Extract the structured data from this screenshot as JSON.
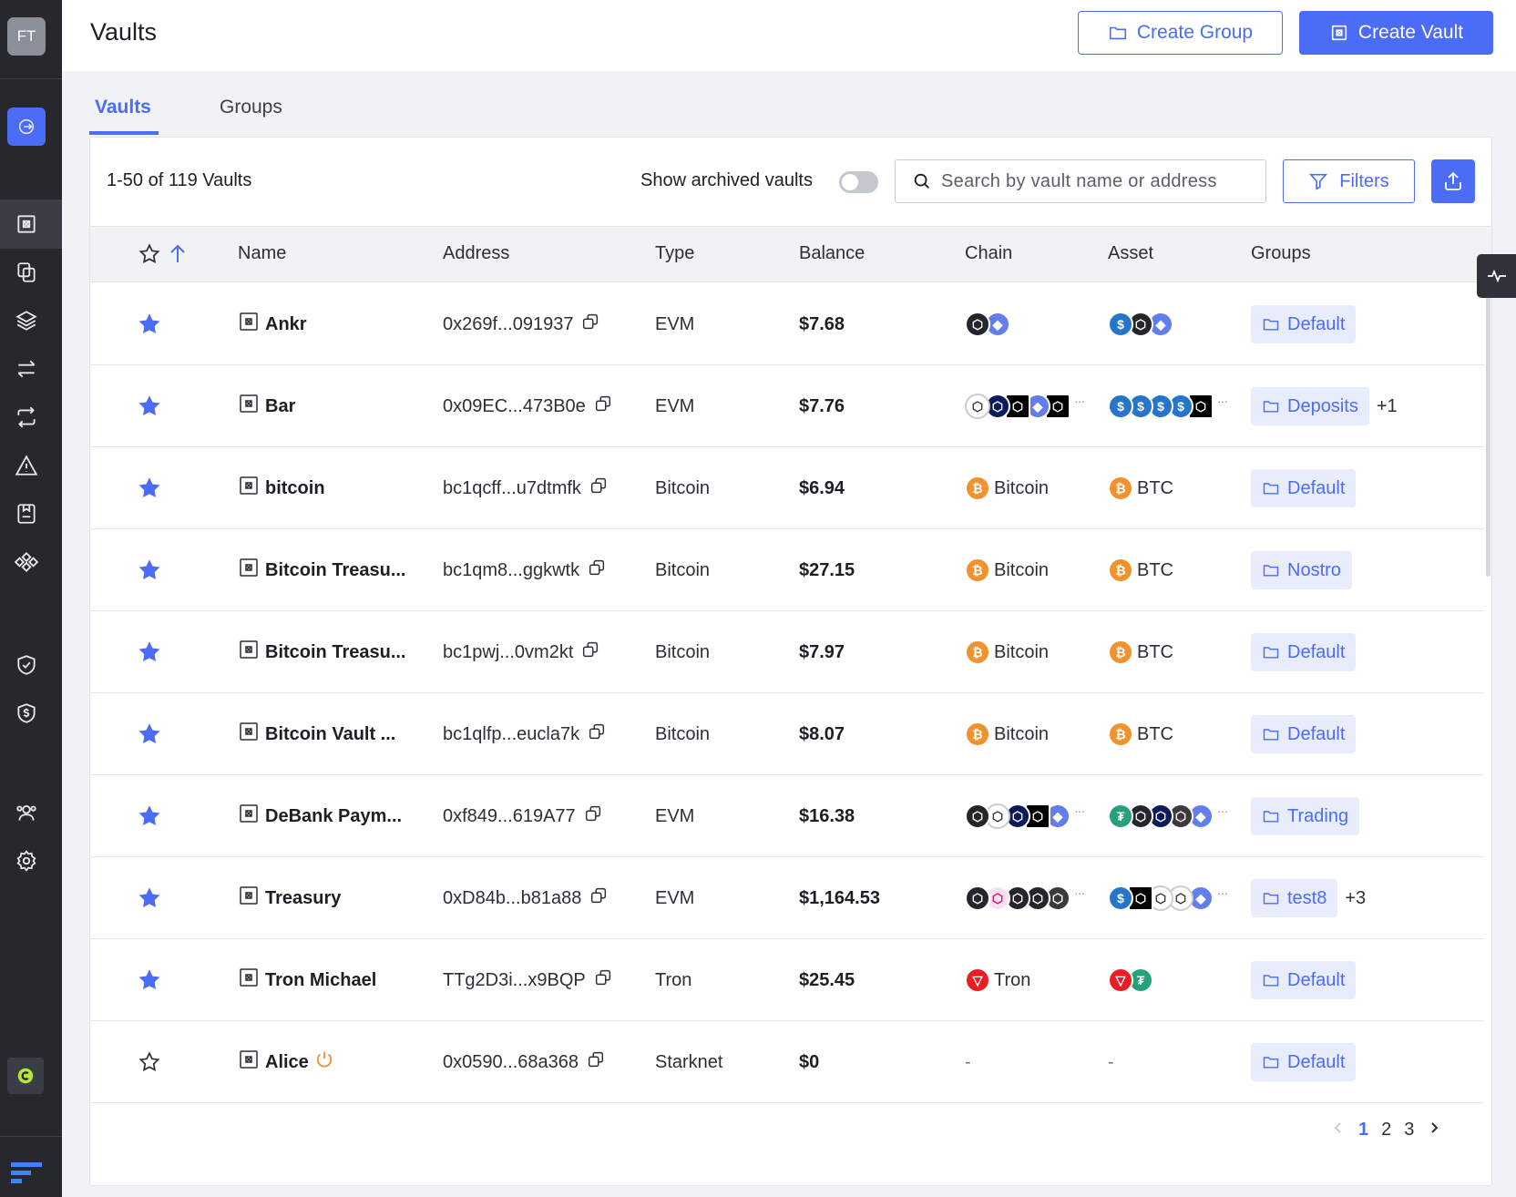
{
  "user": {
    "initials": "FT"
  },
  "header": {
    "title": "Vaults",
    "create_group": "Create Group",
    "create_vault": "Create Vault"
  },
  "tabs": [
    {
      "label": "Vaults",
      "active": true
    },
    {
      "label": "Groups",
      "active": false
    }
  ],
  "toolbar": {
    "count": "1-50 of 119 Vaults",
    "archived_label": "Show archived vaults",
    "archived_on": false,
    "search_placeholder": "Search by vault name or address",
    "filters_label": "Filters"
  },
  "columns": [
    "Name",
    "Address",
    "Type",
    "Balance",
    "Chain",
    "Asset",
    "Groups"
  ],
  "rows": [
    {
      "starred": true,
      "name": "Ankr",
      "address": "0x269f...091937",
      "type": "EVM",
      "balance": "$7.68",
      "chain_icons": [
        "dark",
        "eth"
      ],
      "chain_label": "",
      "asset_icons": [
        "usdc",
        "dark",
        "eth"
      ],
      "asset_label": "",
      "group": "Default",
      "group_extra": ""
    },
    {
      "starred": true,
      "name": "Bar",
      "address": "0x09EC...473B0e",
      "type": "EVM",
      "balance": "$7.76",
      "chain_icons": [
        "white",
        "blue-dark",
        "black",
        "eth",
        "black"
      ],
      "chain_label": "",
      "asset_icons": [
        "usdc",
        "usdc",
        "usdc",
        "usdc",
        "black"
      ],
      "asset_label": "",
      "group": "Deposits",
      "group_extra": "+1"
    },
    {
      "starred": true,
      "name": "bitcoin",
      "address": "bc1qcff...u7dtmfk",
      "type": "Bitcoin",
      "balance": "$6.94",
      "chain_icons": [
        "btc"
      ],
      "chain_label": "Bitcoin",
      "asset_icons": [
        "btc"
      ],
      "asset_label": "BTC",
      "group": "Default",
      "group_extra": ""
    },
    {
      "starred": true,
      "name": "Bitcoin Treasu...",
      "address": "bc1qm8...ggkwtk",
      "type": "Bitcoin",
      "balance": "$27.15",
      "chain_icons": [
        "btc"
      ],
      "chain_label": "Bitcoin",
      "asset_icons": [
        "btc"
      ],
      "asset_label": "BTC",
      "group": "Nostro",
      "group_extra": ""
    },
    {
      "starred": true,
      "name": "Bitcoin Treasu...",
      "address": "bc1pwj...0vm2kt",
      "type": "Bitcoin",
      "balance": "$7.97",
      "chain_icons": [
        "btc"
      ],
      "chain_label": "Bitcoin",
      "asset_icons": [
        "btc"
      ],
      "asset_label": "BTC",
      "group": "Default",
      "group_extra": ""
    },
    {
      "starred": true,
      "name": "Bitcoin Vault ...",
      "address": "bc1qlfp...eucla7k",
      "type": "Bitcoin",
      "balance": "$8.07",
      "chain_icons": [
        "btc"
      ],
      "chain_label": "Bitcoin",
      "asset_icons": [
        "btc"
      ],
      "asset_label": "BTC",
      "group": "Default",
      "group_extra": ""
    },
    {
      "starred": true,
      "name": "DeBank Paym...",
      "address": "0xf849...619A77",
      "type": "EVM",
      "balance": "$16.38",
      "chain_icons": [
        "dark",
        "white",
        "blue-dark",
        "black",
        "eth"
      ],
      "chain_label": "",
      "asset_icons": [
        "teal",
        "dark",
        "blue-dark",
        "green",
        "eth"
      ],
      "asset_label": "",
      "group": "Trading",
      "group_extra": ""
    },
    {
      "starred": true,
      "name": "Treasury",
      "address": "0xD84b...b81a88",
      "type": "EVM",
      "balance": "$1,164.53",
      "chain_icons": [
        "dark",
        "pink",
        "dark",
        "dark",
        "green"
      ],
      "chain_label": "",
      "asset_icons": [
        "usdc",
        "black",
        "white",
        "white",
        "eth"
      ],
      "asset_label": "",
      "group": "test8",
      "group_extra": "+3"
    },
    {
      "starred": true,
      "name": "Tron Michael",
      "address": "TTg2D3i...x9BQP",
      "type": "Tron",
      "balance": "$25.45",
      "chain_icons": [
        "tron"
      ],
      "chain_label": "Tron",
      "asset_icons": [
        "tron",
        "teal"
      ],
      "asset_label": "",
      "group": "Default",
      "group_extra": ""
    },
    {
      "starred": false,
      "name": "Alice",
      "address": "0x0590...68a368",
      "type": "Starknet",
      "balance": "$0",
      "chain_icons": [],
      "chain_label": "-",
      "asset_icons": [],
      "asset_label": "-",
      "group": "Default",
      "group_extra": "",
      "pending": true
    }
  ],
  "pagination": {
    "pages": [
      "1",
      "2",
      "3"
    ],
    "current": "1"
  },
  "colors": {
    "accent": "#4a6cf7",
    "sidebar": "#26282d",
    "star": "#4a6cf7"
  }
}
